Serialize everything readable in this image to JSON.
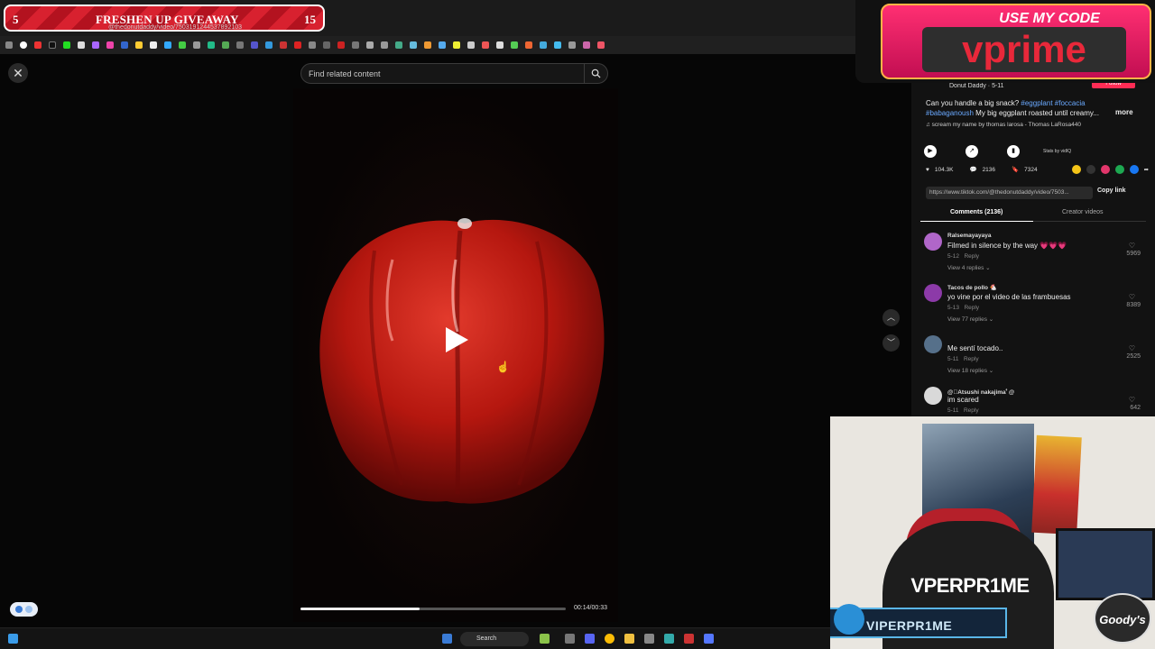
{
  "giveaway": {
    "left_number": "5",
    "title": "FRESHEN UP GIVEAWAY",
    "right_number": "15",
    "url": "@thedonutdaddy/video/7503191244537892103"
  },
  "search": {
    "placeholder": "Find related content"
  },
  "video": {
    "progress": 0.45,
    "timecode": "00:14/00:33"
  },
  "promo": {
    "tagline": "USE MY CODE",
    "code": "vprime"
  },
  "post": {
    "author": "Donut Daddy · 5-11",
    "follow_label": "Follow",
    "caption_hashtags_1": "#eggplant #foccacia",
    "caption_prefix": "Can you handle a big snack? ",
    "caption_hashtags_2": "#babaganoush",
    "caption_rest": " My big eggplant roasted until creamy...",
    "more_label": "more",
    "music": "♫  scream my name by thomas larosa - Thomas LaRosa440",
    "stats_by": "Stats by vidIQ",
    "likes": "104.3K",
    "comments": "2136",
    "saves": "7324",
    "link": "https://www.tiktok.com/@thedonutdaddy/video/7503...",
    "copy_link_label": "Copy link"
  },
  "tabs": {
    "comments": "Comments (2136)",
    "creator": "Creator videos"
  },
  "comments": [
    {
      "user": "Ralsemayayaya",
      "text": "Filmed in silence by the way 💗💗💗",
      "date": "5-12",
      "reply": "Reply",
      "replies": "View 4 replies ⌄",
      "likes": "5969",
      "color": "#b066c9"
    },
    {
      "user": "Tacos de pollo 🐔",
      "text": "yo vine por el video de las frambuesas",
      "date": "5-13",
      "reply": "Reply",
      "replies": "View 77 replies ⌄",
      "likes": "8389",
      "color": "#8c3aa8"
    },
    {
      "user": "",
      "text": "Me sentí tocado..",
      "date": "5-11",
      "reply": "Reply",
      "replies": "View 18 replies ⌄",
      "likes": "2525",
      "color": "#56708a"
    },
    {
      "user": "@ﾟAtsushi nakajimaﾟ@",
      "text": "im scared",
      "date": "5-11",
      "reply": "Reply",
      "replies": "",
      "likes": "642",
      "color": "#d9d9d9"
    }
  ],
  "webcam": {
    "shirt_text": "VPERPR1ME",
    "handle": "VIPERPR1ME",
    "brand": "Goody's"
  },
  "taskbar": {
    "search_label": "Search"
  },
  "icons": {
    "close": "close-icon",
    "search": "search-icon",
    "play": "play-icon",
    "up": "chevron-up-icon",
    "down": "chevron-down-icon"
  }
}
